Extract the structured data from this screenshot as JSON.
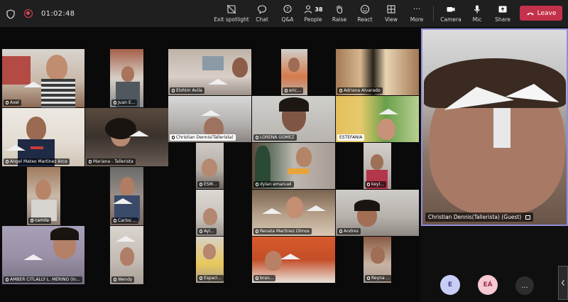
{
  "meeting": {
    "timer": "01:02:48"
  },
  "toolbar": {
    "exit_spotlight": "Exit spotlight",
    "chat": "Chat",
    "qa": "Q&A",
    "people": "People",
    "people_count": "38",
    "raise": "Raise",
    "react": "React",
    "view": "View",
    "more": "More",
    "camera": "Camera",
    "mic": "Mic",
    "share": "Share",
    "leave": "Leave"
  },
  "participants": [
    {
      "name": "Axel"
    },
    {
      "name": "Juan E..."
    },
    {
      "name": "Elohim Avila"
    },
    {
      "name": "eric..."
    },
    {
      "name": "Adriana Alvarado"
    },
    {
      "name": "Angel Mateo Martinez Arce"
    },
    {
      "name": "Mariana - Tallerista"
    },
    {
      "name": "Christian Dennis(Tallerista)"
    },
    {
      "name": "LORENA GOMEZ"
    },
    {
      "name": "ESTEFANIA"
    },
    {
      "name": "ESM..."
    },
    {
      "name": "dylan emanuel"
    },
    {
      "name": "keyl..."
    },
    {
      "name": "camila"
    },
    {
      "name": "Carlos ..."
    },
    {
      "name": "Ayl..."
    },
    {
      "name": "Renata Martinez Olmos"
    },
    {
      "name": "Andres"
    },
    {
      "name": "AMBER CITLALLY L. MERINO (In..."
    },
    {
      "name": "Wendy"
    },
    {
      "name": "Espaci..."
    },
    {
      "name": "bran..."
    },
    {
      "name": "Reyna ..."
    }
  ],
  "spotlight": {
    "name": "Christian Dennis(Tallerista) (Guest)"
  },
  "overflow_avatars": [
    {
      "initials": "E",
      "color": "#c8cdf5"
    },
    {
      "initials": "EÁ",
      "color": "#f4c9d2"
    }
  ],
  "more_participants": "..."
}
